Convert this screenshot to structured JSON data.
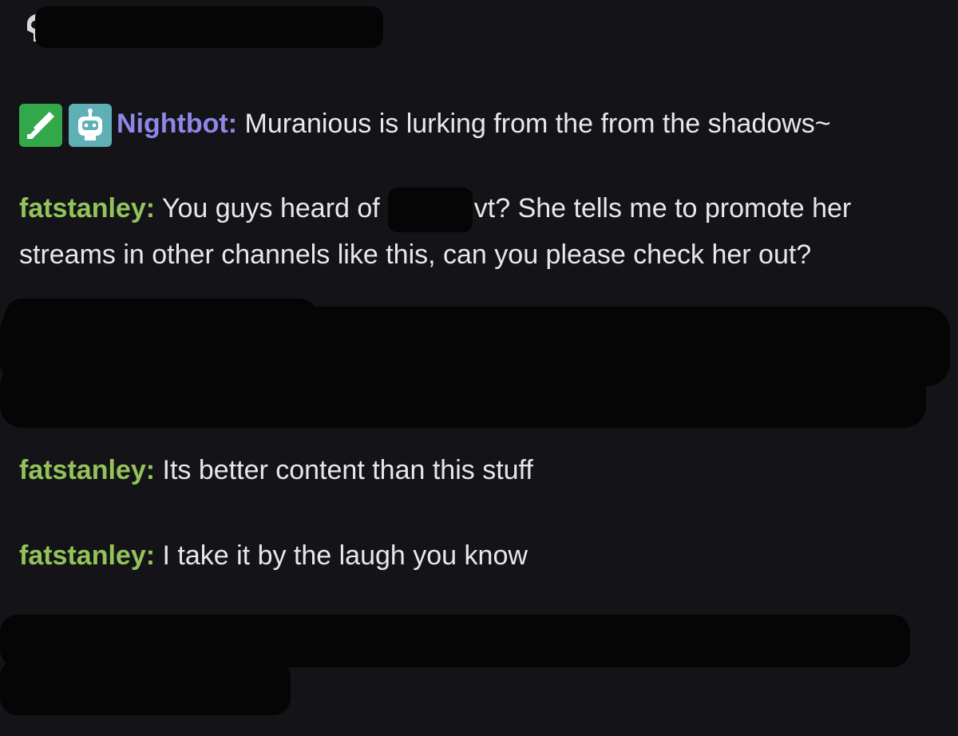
{
  "chat": {
    "messages": [
      {
        "user": "Nightbot",
        "user_color": "#8f86e8",
        "text": "Muranious is lurking from the from the shadows~",
        "badges": [
          "sword-badge-icon",
          "robot-badge-icon"
        ]
      },
      {
        "user": "fatstanley",
        "user_color": "#93c35a",
        "text_before_redaction": "You guys heard of",
        "text_after_redaction": "vt? She tells me to promote her",
        "text_line2": "streams in other channels like this, can you please check her out?"
      },
      {
        "user": "fatstanley",
        "user_color": "#93c35a",
        "text": "Its better content than this stuff"
      },
      {
        "user": "fatstanley",
        "user_color": "#93c35a",
        "text": "I take it by the laugh you know"
      }
    ],
    "separator": ":"
  },
  "colors": {
    "background": "#141418",
    "message_text": "#e8e8ec",
    "redaction": "#050506",
    "nightbot": "#8f86e8",
    "fatstanley": "#93c35a"
  }
}
